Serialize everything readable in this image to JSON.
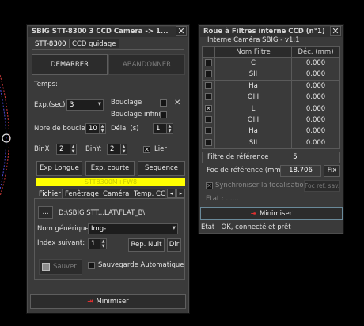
{
  "colors": {
    "accent_yellow": "#ffff00",
    "arrow_red": "#e03030"
  },
  "camera": {
    "title": "SBIG STT-8300 3 CCD Camera   ->  1...",
    "close": "✕",
    "tabs": [
      "STT-8300",
      "CCD guidage"
    ],
    "start_button": "DEMARRER",
    "abort_button": "ABANDONNER",
    "temps_label": "Temps:",
    "exp_label": "Exp.(sec)",
    "exp_value": "3",
    "bouclage_label": "Bouclage",
    "bouclage_infini_label": "Bouclage infini",
    "clear_icon": "✕",
    "nbre_boucles_label": "Nbre de boucles",
    "nbre_boucles_value": "10",
    "delai_label": "Délai (s)",
    "delai_value": "1",
    "binx_label": "BinX",
    "binx_value": "2",
    "biny_label": "BinY:",
    "biny_value": "2",
    "lier_label": "Lier",
    "lier_check": "✕",
    "exp_longue": "Exp Longue",
    "exp_courte": "Exp. courte",
    "sequence": "Sequence",
    "status_bar": "STT8300M+FW8",
    "lower_tabs": [
      "Fichier",
      "Fenêtrage",
      "Caméra",
      "Temp. CCD"
    ],
    "tab_scroll_left": "◂",
    "tab_scroll_right": "▸",
    "browse_button": "...",
    "path": "D:\\SBIG STT...LAT\\FLAT_B\\",
    "nom_generique_label": "Nom générique:",
    "nom_generique_value": "Img-",
    "index_label": "Index suivant:",
    "index_value": "1",
    "rep_nuit": "Rep. Nuit",
    "dir_button": "Dir",
    "sauver": "Sauver",
    "sauvegarde_auto": "Sauvegarde Automatique",
    "minimiser": "Minimiser"
  },
  "filters": {
    "title": "Roue à Filtres interne CCD (n°1)",
    "close": "✕",
    "subtitle": "Interne Caméra SBIG - v1.1",
    "headers": [
      "Nom Filtre",
      "Déc. (mm)"
    ],
    "rows": [
      {
        "name": "C",
        "offset": "0.000",
        "checked": ""
      },
      {
        "name": "SII",
        "offset": "0.000",
        "checked": ""
      },
      {
        "name": "Ha",
        "offset": "0.000",
        "checked": ""
      },
      {
        "name": "OIII",
        "offset": "0.000",
        "checked": ""
      },
      {
        "name": "L",
        "offset": "0.000",
        "checked": "✕"
      },
      {
        "name": "OIII",
        "offset": "0.000",
        "checked": ""
      },
      {
        "name": "Ha",
        "offset": "0.000",
        "checked": ""
      },
      {
        "name": "SII",
        "offset": "0.000",
        "checked": ""
      }
    ],
    "ref_filter_label": "Filtre de référence",
    "ref_filter_value": "5",
    "ref_focus_label": "Foc de référence (mm)",
    "ref_focus_value": "18.706",
    "fix_button": "Fix",
    "sync_label": "Synchroniser la focalisation",
    "sync_check": "✕",
    "foc_ref_button": "Foc ref. sav.",
    "etat_label": "Etat : ......",
    "minimiser": "Minimiser",
    "status": "Etat : OK, connecté et prêt"
  }
}
